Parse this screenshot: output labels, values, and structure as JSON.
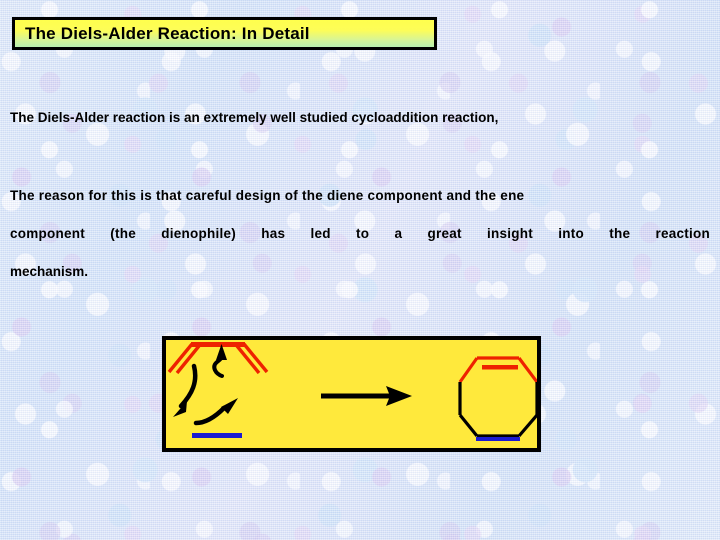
{
  "slide": {
    "title": "The Diels-Alder Reaction:  In Detail",
    "background_color": "#d4e3f6",
    "title_box": {
      "border_color": "#000000",
      "gradient_from": "#ffff4d",
      "gradient_to": "#b8f0b0"
    }
  },
  "body": {
    "paragraph1": "The Diels-Alder reaction is an extremely well studied cycloaddition reaction,",
    "paragraph2_line1": "The reason for this is that careful design of the diene component and the ene",
    "paragraph2_line2": "component (the dienophile) has led to a great insight into the reaction",
    "paragraph2_line3": "mechanism.",
    "text_color": "#000000"
  },
  "scheme": {
    "name": "diels-alder-reaction-scheme",
    "panel_color": "#ffe93c",
    "border_color": "#000000",
    "diene_color": "#ee2200",
    "dienophile_color": "#1b1bd0",
    "product_sigma_color": "#000000",
    "arrow_color": "#000000",
    "elements": [
      "s-cis-diene",
      "dienophile-alkene",
      "curly-arrow-up",
      "curly-arrow-down-left",
      "curly-arrow-up-right",
      "reaction-arrow",
      "cyclohexene-product"
    ]
  }
}
